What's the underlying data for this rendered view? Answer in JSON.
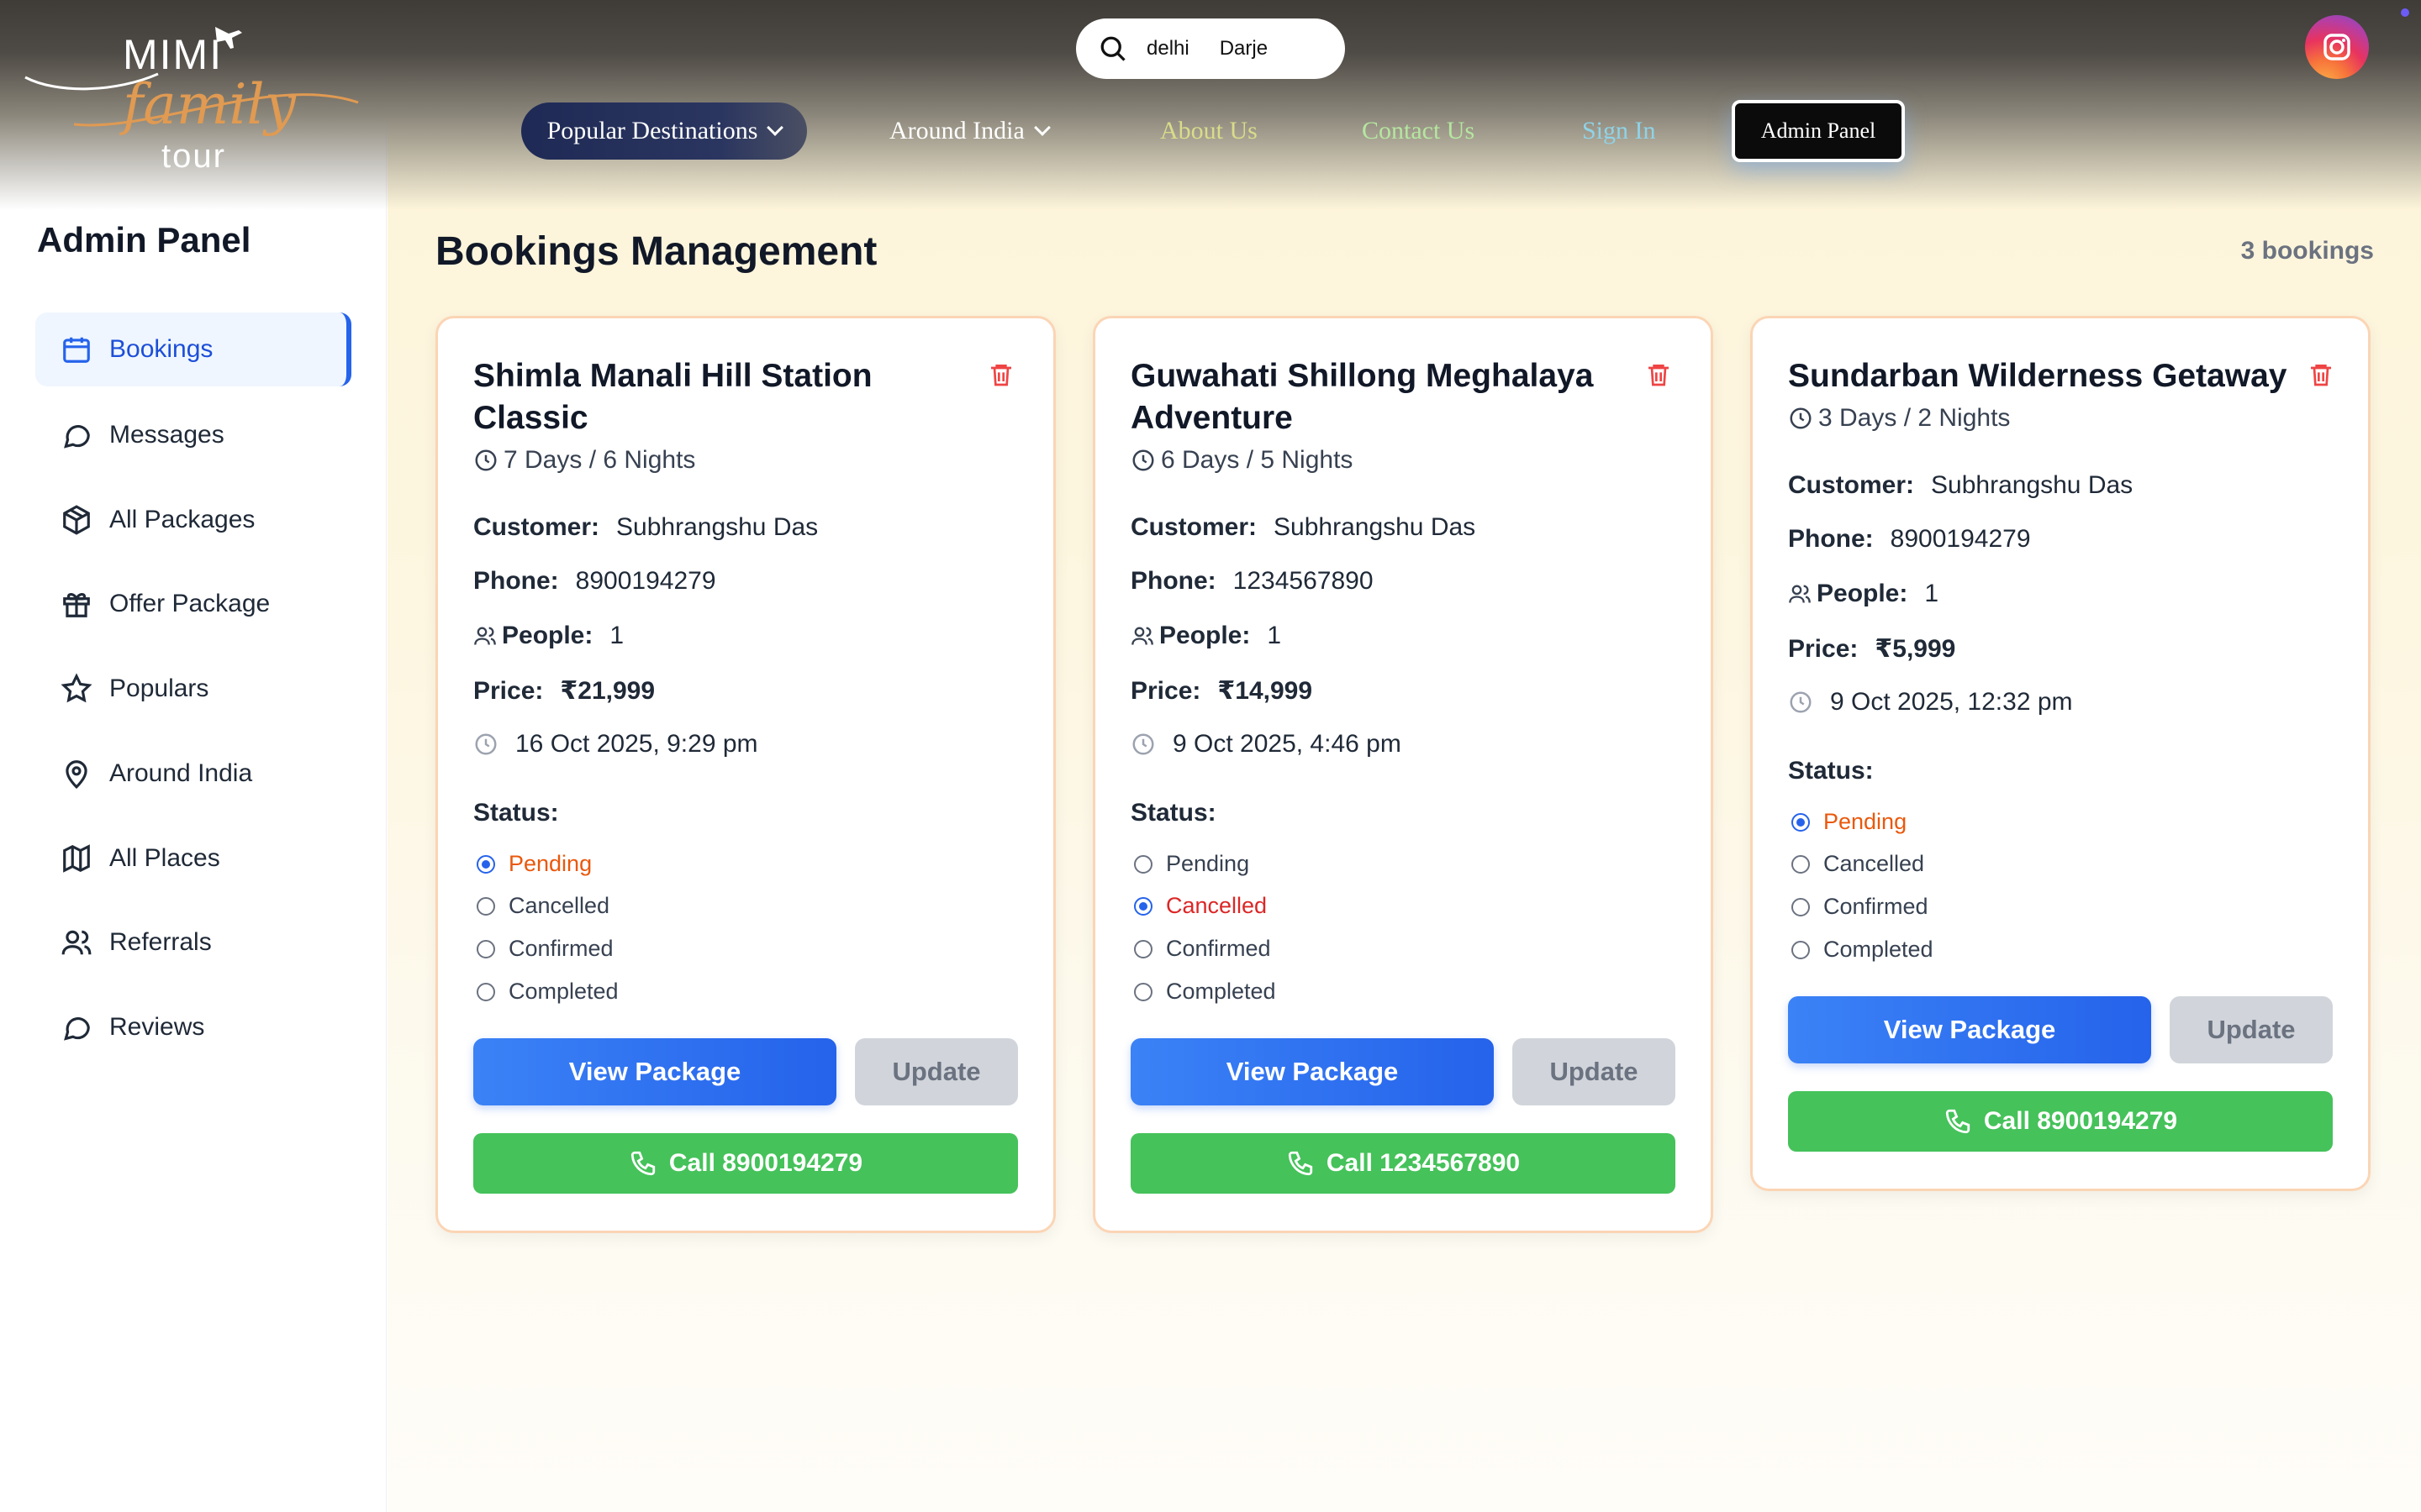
{
  "brand": {
    "line1": "MIMI",
    "line2": "family",
    "line3": "tour"
  },
  "search": {
    "city": "delhi",
    "value": "Darje"
  },
  "nav": {
    "popular": "Popular Destinations",
    "around": "Around India",
    "about": "About Us",
    "contact": "Contact Us",
    "signin": "Sign In",
    "admin": "Admin Panel"
  },
  "sidebar": {
    "title": "Admin Panel",
    "items": [
      {
        "label": "Bookings",
        "icon": "calendar-icon"
      },
      {
        "label": "Messages",
        "icon": "chat-icon"
      },
      {
        "label": "All Packages",
        "icon": "package-icon"
      },
      {
        "label": "Offer Package",
        "icon": "gift-icon"
      },
      {
        "label": "Populars",
        "icon": "star-icon"
      },
      {
        "label": "Around India",
        "icon": "map-pin-icon"
      },
      {
        "label": "All Places",
        "icon": "map-icon"
      },
      {
        "label": "Referrals",
        "icon": "users-icon"
      },
      {
        "label": "Reviews",
        "icon": "chat-icon"
      }
    ]
  },
  "main": {
    "title": "Bookings Management",
    "count": "3 bookings"
  },
  "labels": {
    "customer": "Customer:",
    "phone": "Phone:",
    "people": "People:",
    "price": "Price:",
    "status": "Status:",
    "view": "View Package",
    "update": "Update",
    "statuses": [
      "Pending",
      "Cancelled",
      "Confirmed",
      "Completed"
    ]
  },
  "bookings": [
    {
      "title": "Shimla Manali Hill Station Classic",
      "duration": "7 Days / 6 Nights",
      "customer": "Subhrangshu Das",
      "phone": "8900194279",
      "people": "1",
      "price": "₹21,999",
      "date": "16 Oct 2025, 9:29 pm",
      "status": "Pending",
      "call": "Call 8900194279"
    },
    {
      "title": "Guwahati Shillong Meghalaya Adventure",
      "duration": "6 Days / 5 Nights",
      "customer": "Subhrangshu Das",
      "phone": "1234567890",
      "people": "1",
      "price": "₹14,999",
      "date": "9 Oct 2025, 4:46 pm",
      "status": "Cancelled",
      "call": "Call 1234567890"
    },
    {
      "title": "Sundarban Wilderness Getaway",
      "duration": "3 Days / 2 Nights",
      "customer": "Subhrangshu Das",
      "phone": "8900194279",
      "people": "1",
      "price": "₹5,999",
      "date": "9 Oct 2025, 12:32 pm",
      "status": "Pending",
      "call": "Call 8900194279"
    }
  ],
  "colors": {
    "accent": "#2563eb",
    "call_green": "#45c25a",
    "pending": "#ea580c",
    "cancelled": "#dc2626",
    "card_border": "#fbd5b5"
  }
}
